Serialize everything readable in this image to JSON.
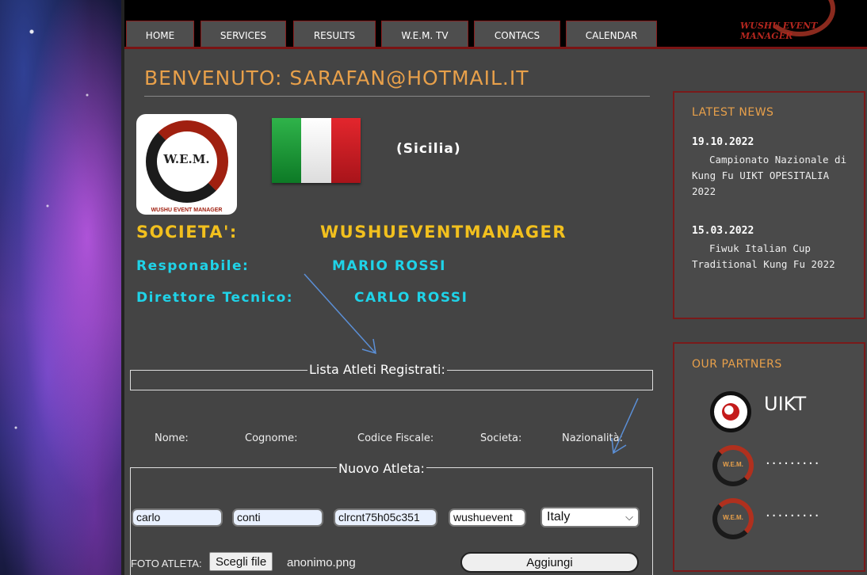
{
  "nav": {
    "items": [
      {
        "label": "HOME"
      },
      {
        "label": "SERVICES"
      },
      {
        "label": "RESULTS"
      },
      {
        "label": "W.E.M. TV"
      },
      {
        "label": "CONTACS"
      },
      {
        "label": "CALENDAR"
      }
    ],
    "logo_text": "WUSHU EVENT MANAGER"
  },
  "header": {
    "welcome": "BENVENUTO:  SARAFAN@HOTMAIL.IT"
  },
  "profile": {
    "logo_text": "W.E.M.",
    "logo_subtext": "WUSHU EVENT MANAGER",
    "region": "(Sicilia)",
    "societa_label": "SOCIETA':",
    "societa_value": "WUSHUEVENTMANAGER",
    "responsabile_label": "Responabile:",
    "responsabile_value": "MARIO ROSSI",
    "direttore_label": "Direttore Tecnico:",
    "direttore_value": "CARLO ROSSI"
  },
  "athletes_list": {
    "legend": "Lista Atleti Registrati:"
  },
  "new_athlete": {
    "legend": "Nuovo Atleta:",
    "headers": {
      "nome": "Nome:",
      "cognome": "Cognome:",
      "codice_fiscale": "Codice Fiscale:",
      "societa": "Societa:",
      "nazionalita": "Nazionalità:"
    },
    "values": {
      "nome": "carlo",
      "cognome": "conti",
      "codice_fiscale": "clrcnt75h05c351",
      "societa": "wushuevent",
      "nazionalita": "Italy"
    },
    "foto_label": "FOTO ATLETA:",
    "file_button": "Scegli file",
    "file_name": "anonimo.png",
    "add_button": "Aggiungi"
  },
  "sidebar": {
    "news_title": "LATEST NEWS",
    "news": [
      {
        "date": "19.10.2022",
        "text": "Campionato Nazionale di Kung Fu UIKT OPESITALIA 2022"
      },
      {
        "date": "15.03.2022",
        "text": "Fiwuk Italian Cup Traditional Kung Fu 2022"
      }
    ],
    "partners_title": "OUR PARTNERS",
    "partners": [
      {
        "name": "UIKT"
      },
      {
        "name": "........."
      },
      {
        "name": "........."
      }
    ],
    "partner_logo_text": "W.E.M."
  },
  "colors": {
    "accent_orange": "#e8a04a",
    "yellow": "#f2c01e",
    "cyan": "#1fd3e8",
    "border_red": "#7a1a1a"
  }
}
